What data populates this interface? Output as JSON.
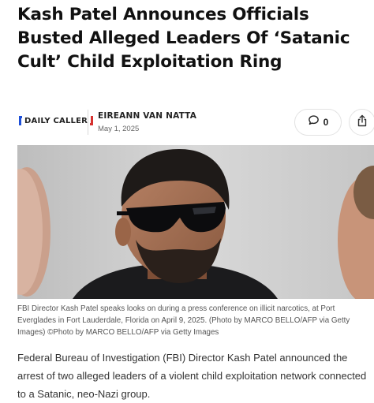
{
  "article": {
    "headline": "Kash Patel Announces Officials Busted Alleged Leaders Of ‘Satanic Cult’ Child Exploitation Ring",
    "publisher_logo": "DAILY CALLER",
    "author": "EIREANN VAN NATTA",
    "date": "May 1, 2025",
    "comment_count": "0",
    "photo_caption": "FBI Director Kash Patel speaks looks on during a press conference on illicit narcotics, at Port Everglades in Fort Lauderdale, Florida on April 9, 2025. (Photo by MARCO BELLO/AFP via Getty Images) ©Photo by MARCO BELLO/AFP via Getty Images",
    "body_paragraph": "Federal Bureau of Investigation (FBI) Director Kash Patel announced the arrest of two alleged leaders of a violent child exploitation network connected to a Satanic, neo-Nazi group."
  },
  "icons": {
    "comment": "speech-bubble-icon",
    "share": "share-icon"
  },
  "colors": {
    "logo_blue": "#1d4fd8",
    "logo_red": "#d63230",
    "headline": "#111111",
    "body_text": "#333333"
  }
}
